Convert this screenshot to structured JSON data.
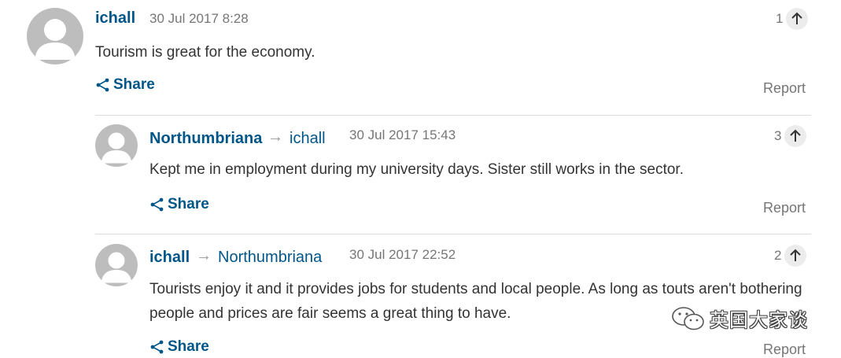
{
  "comments": [
    {
      "author": "ichall",
      "reply_to": "",
      "timestamp": "30 Jul 2017 8:28",
      "text": "Tourism is great for the economy.",
      "recommend_count": "1",
      "share_label": "Share",
      "report_label": "Report"
    },
    {
      "author": "Northumbriana",
      "reply_to": "ichall",
      "timestamp": "30 Jul 2017 15:43",
      "text": "Kept me in employment during my university days. Sister still works in the sector.",
      "recommend_count": "3",
      "share_label": "Share",
      "report_label": "Report"
    },
    {
      "author": "ichall",
      "reply_to": "Northumbriana",
      "timestamp": "30 Jul 2017 22:52",
      "text": "Tourists enjoy it and it provides jobs for students and local people. As long as touts aren't bothering people and prices are fair seems a great thing to have.",
      "recommend_count": "2",
      "share_label": "Share",
      "report_label": "Report"
    }
  ],
  "reply_arrow_glyph": "→",
  "watermark": {
    "text": "英国大家谈",
    "icon": "wechat-icon"
  },
  "colors": {
    "link": "#005689",
    "meta": "#767676",
    "avatar": "#bdbdbd"
  }
}
